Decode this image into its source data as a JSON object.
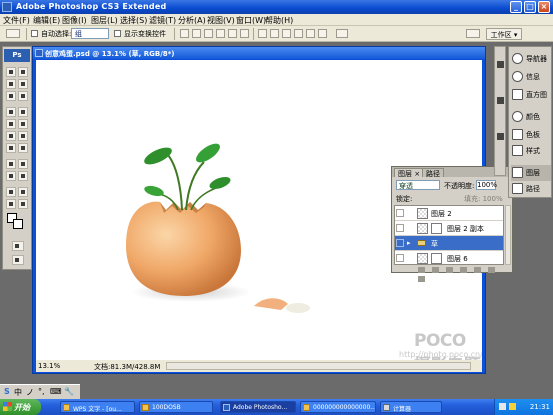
{
  "window": {
    "title": "Adobe Photoshop CS3 Extended"
  },
  "menu": [
    "文件(F)",
    "编辑(E)",
    "图像(I)",
    "图层(L)",
    "选择(S)",
    "滤镜(T)",
    "分析(A)",
    "视图(V)",
    "窗口(W)",
    "帮助(H)"
  ],
  "options": {
    "auto_select_label": "自动选择:",
    "auto_select_value": "组",
    "show_transform_label": "显示变换控件",
    "workspace_label": "工作区"
  },
  "toolbox": {
    "logo": "Ps"
  },
  "document": {
    "tab_title": "创意鸡蛋.psd @ 13.1% (草, RGB/8*)",
    "status_zoom": "13.1%",
    "status_info": "文档:81.3M/428.8M"
  },
  "watermark": {
    "line1": "POCO 摄影专题",
    "line2": "http://photo.poco.cn/"
  },
  "layers_panel": {
    "tabs": [
      "图层 ×",
      "路径"
    ],
    "blend_mode": "穿透",
    "opacity_label": "不透明度:",
    "opacity_value": "100%",
    "lock_label": "锁定:",
    "fill_label": "填充:",
    "fill_value": "100%",
    "layers": [
      {
        "name": "图层 2",
        "selected": false
      },
      {
        "name": "图层 2 副本",
        "selected": false
      },
      {
        "name": "草",
        "selected": true
      },
      {
        "name": "图层 6",
        "selected": false
      }
    ]
  },
  "dock": {
    "items": [
      "导航器",
      "信息",
      "直方图",
      "颜色",
      "色板",
      "样式",
      "图层",
      "路径"
    ]
  },
  "langbar": {
    "items": [
      "中",
      "ノ",
      "°,",
      "⌨",
      "🔧"
    ]
  },
  "taskbar": {
    "start_label": "开始",
    "tasks": [
      "WPS 文字 - [ou...",
      "100DOSB",
      "Adobe Photosho...",
      "000000000000000...",
      "计算器"
    ],
    "clock": "21:31"
  }
}
